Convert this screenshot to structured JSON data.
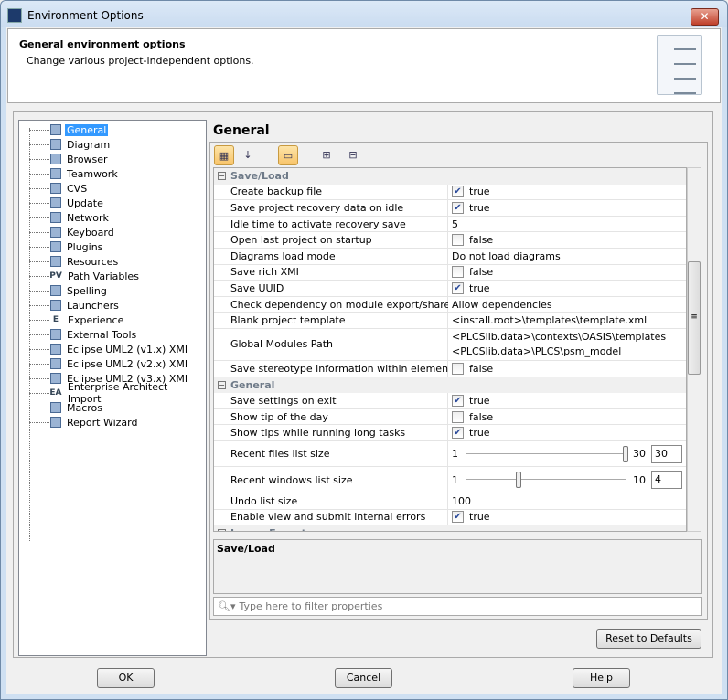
{
  "window": {
    "title": "Environment Options",
    "close_icon": "close-icon"
  },
  "header": {
    "title": "General environment options",
    "subtitle": "Change various project-independent options."
  },
  "tree": {
    "items": [
      {
        "label": "General",
        "icon": "general-icon",
        "selected": true
      },
      {
        "label": "Diagram",
        "icon": "diagram-icon"
      },
      {
        "label": "Browser",
        "icon": "browser-icon"
      },
      {
        "label": "Teamwork",
        "icon": "teamwork-icon"
      },
      {
        "label": "CVS",
        "icon": "cvs-icon"
      },
      {
        "label": "Update",
        "icon": "update-icon"
      },
      {
        "label": "Network",
        "icon": "network-icon"
      },
      {
        "label": "Keyboard",
        "icon": "keyboard-icon"
      },
      {
        "label": "Plugins",
        "icon": "plugins-icon"
      },
      {
        "label": "Resources",
        "icon": "resources-icon"
      },
      {
        "label": "Path Variables",
        "icon": "path-variables-icon"
      },
      {
        "label": "Spelling",
        "icon": "spelling-icon"
      },
      {
        "label": "Launchers",
        "icon": "launchers-icon"
      },
      {
        "label": "Experience",
        "icon": "experience-icon"
      },
      {
        "label": "External Tools",
        "icon": "external-tools-icon"
      },
      {
        "label": "Eclipse UML2 (v1.x) XMI",
        "icon": "eclipse-icon"
      },
      {
        "label": "Eclipse UML2 (v2.x) XMI",
        "icon": "eclipse-icon"
      },
      {
        "label": "Eclipse UML2 (v3.x) XMI",
        "icon": "eclipse-icon"
      },
      {
        "label": "Enterprise Architect Import",
        "icon": "ea-icon"
      },
      {
        "label": "Macros",
        "icon": "macros-icon"
      },
      {
        "label": "Report Wizard",
        "icon": "report-wizard-icon"
      }
    ]
  },
  "main": {
    "title": "General",
    "categories": [
      {
        "name": "Save/Load",
        "rows": [
          {
            "key": "Create backup file",
            "type": "check",
            "checked": true,
            "value": "true"
          },
          {
            "key": "Save project recovery data on idle",
            "type": "check",
            "checked": true,
            "value": "true"
          },
          {
            "key": "Idle time to activate recovery save",
            "type": "text",
            "value": "5"
          },
          {
            "key": "Open last project on startup",
            "type": "check",
            "checked": false,
            "value": "false"
          },
          {
            "key": "Diagrams load mode",
            "type": "text",
            "value": "Do not load diagrams"
          },
          {
            "key": "Save rich XMI",
            "type": "check",
            "checked": false,
            "value": "false"
          },
          {
            "key": "Save UUID",
            "type": "check",
            "checked": true,
            "value": "true"
          },
          {
            "key": "Check dependency on module export/share",
            "type": "text",
            "value": "Allow dependencies"
          },
          {
            "key": "Blank project template",
            "type": "text",
            "value": "<install.root>\\templates\\template.xml"
          },
          {
            "key": "Global Modules Path",
            "type": "multi",
            "values": [
              "<PLCSlib.data>\\contexts\\OASIS\\templates",
              "<PLCSlib.data>\\PLCS\\psm_model"
            ]
          },
          {
            "key": "Save stereotype information within element",
            "type": "check",
            "checked": false,
            "value": "false"
          }
        ]
      },
      {
        "name": "General",
        "rows": [
          {
            "key": "Save settings on exit",
            "type": "check",
            "checked": true,
            "value": "true"
          },
          {
            "key": "Show tip of the day",
            "type": "check",
            "checked": false,
            "value": "false"
          },
          {
            "key": "Show tips while running long tasks",
            "type": "check",
            "checked": true,
            "value": "true"
          },
          {
            "key": "Recent files list size",
            "type": "slider",
            "min": "1",
            "max": "30",
            "value": "30"
          },
          {
            "key": "Recent windows list size",
            "type": "slider",
            "min": "1",
            "max": "10",
            "value": "4"
          },
          {
            "key": "Undo list size",
            "type": "text",
            "value": "100"
          },
          {
            "key": "Enable view and submit internal errors",
            "type": "check",
            "checked": true,
            "value": "true"
          }
        ]
      },
      {
        "name": "Image Export",
        "rows": []
      }
    ],
    "description_title": "Save/Load",
    "filter_placeholder": "Type here to filter properties",
    "reset_label": "Reset to Defaults"
  },
  "footer": {
    "ok": "OK",
    "cancel": "Cancel",
    "help": "Help"
  }
}
